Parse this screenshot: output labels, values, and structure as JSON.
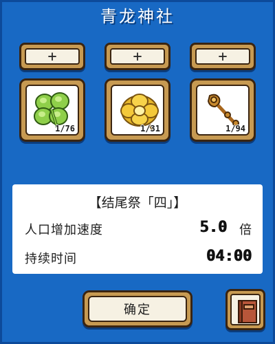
{
  "title": "青龙神社",
  "slots": [
    {
      "add_label": "+",
      "item_icon": "four-leaf-clover-icon",
      "count": "1/76"
    },
    {
      "add_label": "+",
      "item_icon": "golden-flower-icon",
      "count": "1/31"
    },
    {
      "add_label": "+",
      "item_icon": "bronze-staff-icon",
      "count": "1/94"
    }
  ],
  "info": {
    "title": "【结尾祭「四」】",
    "rows": [
      {
        "label": "人口增加速度",
        "value": "5.0",
        "unit": "倍"
      },
      {
        "label": "持续时间",
        "value": "04:00"
      }
    ]
  },
  "confirm_label": "确定",
  "book_icon": "book-icon",
  "colors": {
    "background": "#1565c0",
    "button_frame": "#c79a52",
    "button_face": "#f6f1e3",
    "outline": "#3a2410"
  }
}
